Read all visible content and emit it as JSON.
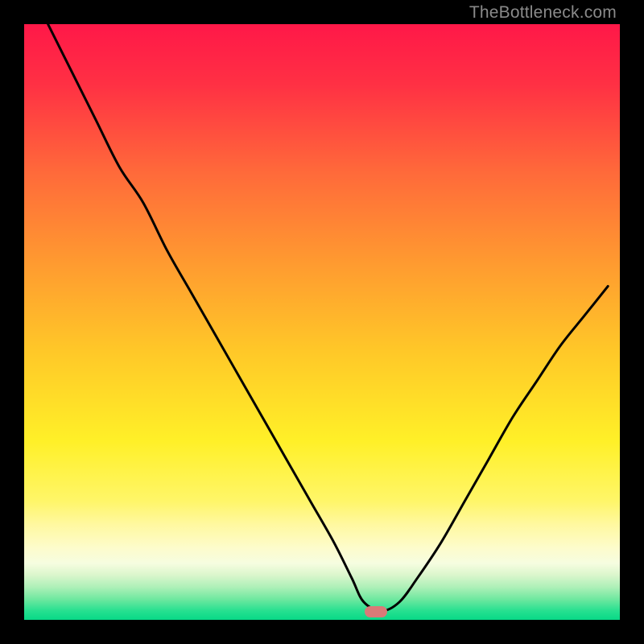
{
  "watermark": "TheBottleneck.com",
  "colors": {
    "frame": "#000000",
    "curve": "#000000",
    "marker": "#d97a78",
    "gradient_stops": [
      {
        "offset": 0.0,
        "color": "#ff1848"
      },
      {
        "offset": 0.1,
        "color": "#ff3044"
      },
      {
        "offset": 0.25,
        "color": "#ff6a3a"
      },
      {
        "offset": 0.4,
        "color": "#ff9a30"
      },
      {
        "offset": 0.55,
        "color": "#ffc828"
      },
      {
        "offset": 0.7,
        "color": "#fff028"
      },
      {
        "offset": 0.8,
        "color": "#fff668"
      },
      {
        "offset": 0.84,
        "color": "#fff8a0"
      },
      {
        "offset": 0.88,
        "color": "#fdfccc"
      },
      {
        "offset": 0.905,
        "color": "#f6fde0"
      },
      {
        "offset": 0.925,
        "color": "#daf6cc"
      },
      {
        "offset": 0.945,
        "color": "#aef0b8"
      },
      {
        "offset": 0.965,
        "color": "#70e8a0"
      },
      {
        "offset": 0.985,
        "color": "#26e090"
      },
      {
        "offset": 1.0,
        "color": "#08d987"
      }
    ]
  },
  "chart_data": {
    "type": "line",
    "title": "",
    "xlabel": "",
    "ylabel": "",
    "xlim": [
      0,
      100
    ],
    "ylim": [
      0,
      100
    ],
    "grid": false,
    "series": [
      {
        "name": "bottleneck-curve",
        "x": [
          4,
          8,
          12,
          16,
          20,
          24,
          28,
          32,
          36,
          40,
          44,
          48,
          52,
          55,
          57,
          60,
          63,
          66,
          70,
          74,
          78,
          82,
          86,
          90,
          94,
          98
        ],
        "y": [
          100,
          92,
          84,
          76,
          70,
          62,
          55,
          48,
          41,
          34,
          27,
          20,
          13,
          7,
          3,
          1.5,
          3,
          7,
          13,
          20,
          27,
          34,
          40,
          46,
          51,
          56
        ]
      }
    ],
    "annotations": [
      {
        "name": "optimum-marker",
        "x": 59,
        "y": 1.3
      }
    ]
  }
}
